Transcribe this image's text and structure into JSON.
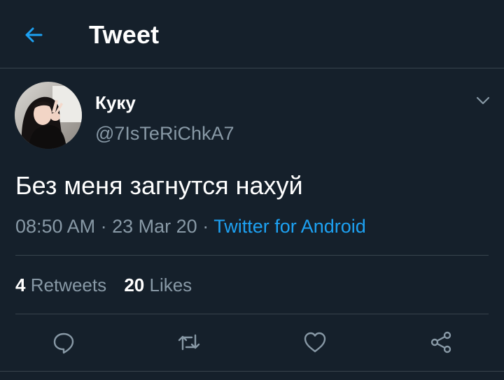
{
  "header": {
    "title": "Tweet",
    "back_icon": "arrow-left-icon"
  },
  "tweet": {
    "author_name": "Куку",
    "author_handle": "@7IsTeRiChkA7",
    "text": "Без меня загнутся нахуй",
    "time": "08:50 AM",
    "date": "23 Mar 20",
    "separator": "·",
    "source": "Twitter for Android"
  },
  "stats": {
    "retweets_count": "4",
    "retweets_label": "Retweets",
    "likes_count": "20",
    "likes_label": "Likes"
  },
  "actions": [
    "reply-icon",
    "retweet-icon",
    "like-icon",
    "share-icon"
  ],
  "colors": {
    "background": "#15202b",
    "accent": "#1da1f2",
    "secondary_text": "#8899a6",
    "divider": "#38444d"
  }
}
